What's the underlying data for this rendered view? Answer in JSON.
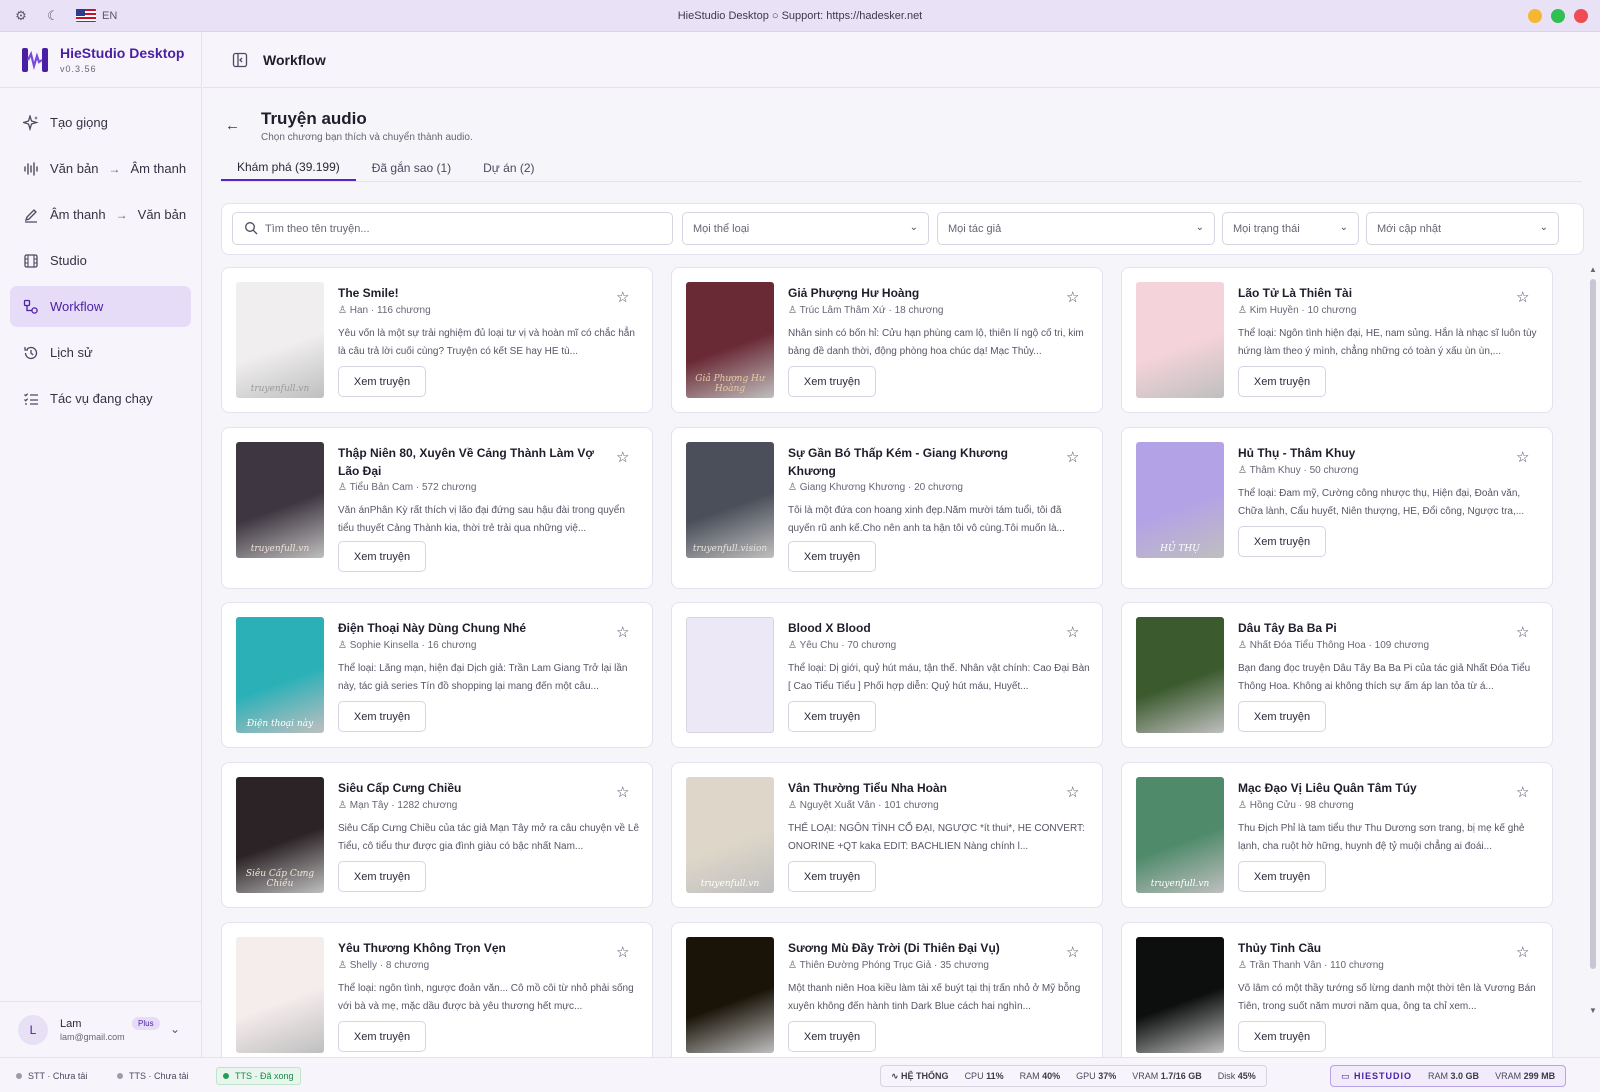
{
  "window": {
    "title": "HieStudio Desktop ○ Support: https://hadesker.net",
    "lang": "EN"
  },
  "brand": {
    "name": "HieStudio Desktop",
    "version": "v0.3.56"
  },
  "nav": [
    {
      "label": "Tạo giọng",
      "icon": "sparkle-icon"
    },
    {
      "label": "Văn bản",
      "label2": "Âm thanh",
      "icon": "waveform-icon"
    },
    {
      "label": "Âm thanh",
      "label2": "Văn bản",
      "icon": "pen-icon"
    },
    {
      "label": "Studio",
      "icon": "film-icon"
    },
    {
      "label": "Workflow",
      "icon": "workflow-icon",
      "active": true
    },
    {
      "label": "Lịch sử",
      "icon": "history-icon"
    },
    {
      "label": "Tác vụ đang chạy",
      "icon": "task-list-icon"
    }
  ],
  "user": {
    "initial": "L",
    "name": "Lam",
    "email": "lam@gmail.com",
    "plan": "Plus"
  },
  "topbar": {
    "title": "Workflow"
  },
  "page": {
    "title": "Truyện audio",
    "subtitle": "Chọn chương bạn thích và chuyển thành audio."
  },
  "tabs": [
    "Khám phá (39.199)",
    "Đã gắn sao (1)",
    "Dự án (2)"
  ],
  "filters": {
    "search_placeholder": "Tìm theo tên truyện...",
    "genre": "Mọi thể loại",
    "author": "Mọi tác giả",
    "status": "Mọi trạng thái",
    "sort": "Mới cập nhật"
  },
  "button_label": "Xem truyện",
  "stories": [
    {
      "title": "The Smile!",
      "author": "Han",
      "chapters": "116 chương",
      "desc": "Yêu vốn là một sự trải nghiệm đủ loại tư vị và hoàn mĩ có chắc hẳn là câu trả lời cuối cùng? Truyện có kết SE hay HE tù..."
    },
    {
      "title": "Giả Phượng Hư Hoàng",
      "author": "Trúc Lâm Thâm Xứ",
      "chapters": "18 chương",
      "desc": "Nhân sinh có bốn hỉ: Cửu hạn phùng cam lộ, thiên lí ngộ cố tri, kim bảng đề danh thời, động phòng hoa chúc dạ! Mạc Thủy..."
    },
    {
      "title": "Lão Tử Là Thiên Tài",
      "author": "Kim Huyền",
      "chapters": "10 chương",
      "desc": "Thể loại: Ngôn tình hiện đại, HE, nam sủng. Hắn là nhạc sĩ luôn tùy hứng làm theo ý mình, chẳng những có toàn ý xấu ùn ùn,..."
    },
    {
      "title": "Thập Niên 80, Xuyên Về Cảng Thành Làm Vợ Lão Đại",
      "author": "Tiểu Bản Cam",
      "chapters": "572 chương",
      "desc": "Văn ánPhân Kỳ rất thích vị lão đại đứng sau hậu đài trong quyển tiểu thuyết Cảng Thành kia, thời trẻ trải qua những việ..."
    },
    {
      "title": "Sự Gần Bó Thấp Kém - Giang Khương Khương",
      "author": "Giang Khương Khương",
      "chapters": "20 chương",
      "desc": "Tôi là một đứa con hoang xinh đẹp.Năm mười tám tuổi, tôi đã quyến rũ anh kế.Cho nên anh ta hận tôi vô cùng.Tôi muốn là..."
    },
    {
      "title": "Hủ Thụ - Thâm Khuy",
      "author": "Thâm Khuy",
      "chapters": "50 chương",
      "desc": "Thể loại: Đam mỹ, Cường công nhược thụ, Hiện đại, Đoản văn, Chữa lành, Cẩu huyết, Niên thượng, HE, Đổi công, Ngược tra,..."
    },
    {
      "title": "Điện Thoại Này Dùng Chung Nhé",
      "author": "Sophie Kinsella",
      "chapters": "16 chương",
      "desc": "Thể loại: Lãng mạn, hiện đại Dịch giả: Trần Lam Giang Trở lại lần này, tác giả series Tín đồ shopping lại mang đến một câu..."
    },
    {
      "title": "Blood X Blood",
      "author": "Yêu Chu",
      "chapters": "70 chương",
      "desc": "Thể loại: Dị giới, quỷ hút máu, tận thế. Nhân vật chính: Cao Đại Bàn [ Cao Tiểu Tiểu ] Phối hợp diễn: Quỷ hút máu, Huyết..."
    },
    {
      "title": "Dâu Tây Ba Ba Pi",
      "author": "Nhất Đóa Tiểu Thông Hoa",
      "chapters": "109 chương",
      "desc": "Bạn đang đọc truyện Dâu Tây Ba Ba Pi của tác giả Nhất Đóa Tiểu Thông Hoa. Không ai không thích sự ấm áp lan tỏa từ á..."
    },
    {
      "title": "Siêu Cấp Cưng Chiều",
      "author": "Mạn Tây",
      "chapters": "1282 chương",
      "desc": "Siêu Cấp Cưng Chiều của tác giả Mạn Tây mở ra câu chuyện về Lê Tiểu, cô tiểu thư được gia đình giàu có bậc nhất Nam..."
    },
    {
      "title": "Vân Thường Tiểu Nha Hoàn",
      "author": "Nguyệt Xuất Vân",
      "chapters": "101 chương",
      "desc": "THỂ LOẠI: NGÔN TÌNH CỔ ĐẠI, NGƯỢC *ít thui*, HE CONVERT: ONORINE +QT kaka EDIT: BACHLIEN Nàng chính l..."
    },
    {
      "title": "Mạc Đạo Vị Liêu Quân Tâm Túy",
      "author": "Hồng Cửu",
      "chapters": "98 chương",
      "desc": "Thu Địch Phỉ là tam tiểu thư Thu Dương sơn trang, bị mẹ kế ghẻ lạnh, cha ruột hờ hững, huynh đệ tỷ muội chẳng ai đoái..."
    },
    {
      "title": "Yêu Thương Không Trọn Vẹn",
      "author": "Shelly",
      "chapters": "8 chương",
      "desc": "Thể loại: ngôn tình, ngược đoản văn... Cô mồ côi từ nhỏ phải sống với bà và mẹ, mặc dầu được bà yêu thương hết mực..."
    },
    {
      "title": "Sương Mù Đầy Trời (Di Thiên Đại Vụ)",
      "author": "Thiên Đường Phóng Trục Giả",
      "chapters": "35 chương",
      "desc": "Một thanh niên Hoa kiều làm tài xế buýt tại thị trấn nhỏ ở Mỹ bỗng xuyên không đến hành tinh Dark Blue cách hai nghìn..."
    },
    {
      "title": "Thủy Tinh Cầu",
      "author": "Trần Thanh Vân",
      "chapters": "110 chương",
      "desc": "Võ lâm có một thầy tướng số lừng danh một thời tên là Vương Bán Tiên, trong suốt năm mươi năm qua, ông ta chỉ xem..."
    }
  ],
  "covers": [
    {
      "bg": "#f0eeee",
      "fg": "#9a9a9a",
      "text": "truyenfull.vn"
    },
    {
      "bg": "#6a2a35",
      "fg": "#e8c9a7",
      "text": "Giả Phượng Hư Hoàng"
    },
    {
      "bg": "#f4d3da",
      "fg": "#2a1a1f",
      "text": ""
    },
    {
      "bg": "#3e3640",
      "fg": "#f2e2d8",
      "text": "truyenfull.vn"
    },
    {
      "bg": "#4a4f5a",
      "fg": "#e9e3dc",
      "text": "truyenfull.vision"
    },
    {
      "bg": "#b4a2e6",
      "fg": "#ffffff",
      "text": "HỦ THỤ"
    },
    {
      "bg": "#2bb0b8",
      "fg": "#ffffff",
      "text": "Điện thoại này"
    },
    {
      "bg": "",
      "fg": "",
      "text": ""
    },
    {
      "bg": "#3b5a2e",
      "fg": "#cfe9b2",
      "text": ""
    },
    {
      "bg": "#2b2326",
      "fg": "#f3e7d8",
      "text": "Siêu Cấp Cưng Chiều"
    },
    {
      "bg": "#ded7c9",
      "fg": "#ffffff",
      "text": "truyenfull.vn"
    },
    {
      "bg": "#4f8a6a",
      "fg": "#ffffff",
      "text": "truyenfull.vn"
    },
    {
      "bg": "#f5ecec",
      "fg": "#c58b95",
      "text": ""
    },
    {
      "bg": "#1a1408",
      "fg": "#e7b94a",
      "text": ""
    },
    {
      "bg": "#0c0f0e",
      "fg": "#3bd36a",
      "text": ""
    }
  ],
  "status": {
    "stt": "STT · Chưa tải",
    "tts1": "TTS · Chưa tải",
    "tts2": "TTS · Đã xong",
    "system_label": "HỆ THỐNG",
    "cpu_label": "CPU",
    "cpu": "11%",
    "ram_label": "RAM",
    "ram": "40%",
    "gpu_label": "GPU",
    "gpu": "37%",
    "vram_label": "VRAM",
    "vram": "1.7/16 GB",
    "disk_label": "Disk",
    "disk": "45%",
    "app_label": "HIESTUDIO",
    "app_ram_label": "RAM",
    "app_ram": "3.0 GB",
    "app_vram_label": "VRAM",
    "app_vram": "299 MB"
  },
  "colors": {
    "accent": "#5a24c9",
    "active_nav_bg": "#e6dcf8",
    "success": "#1fa055"
  }
}
